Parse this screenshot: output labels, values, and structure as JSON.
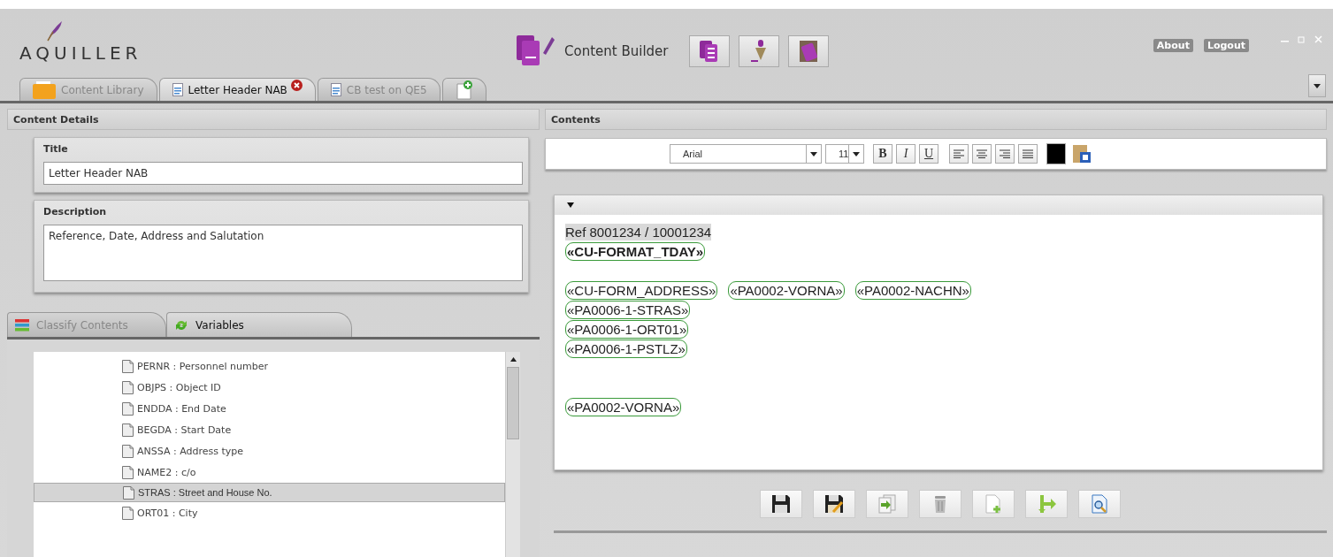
{
  "header": {
    "logo": "AQUILLER",
    "app_title": "Content Builder",
    "links": [
      "About",
      "Logout"
    ]
  },
  "tabs": [
    {
      "label": "Content Library",
      "selected": false,
      "closable": false,
      "kind": "library"
    },
    {
      "label": "Letter Header NAB",
      "selected": true,
      "closable": true,
      "kind": "document"
    },
    {
      "label": "CB test on QE5",
      "selected": false,
      "closable": false,
      "kind": "document"
    }
  ],
  "content_details": {
    "heading": "Content Details",
    "title_label": "Title",
    "title_value": "Letter Header NAB",
    "description_label": "Description",
    "description_value": "Reference, Date, Address and Salutation"
  },
  "sub_tabs": [
    {
      "label": "Classify Contents",
      "selected": false,
      "kind": "classify"
    },
    {
      "label": "Variables",
      "selected": true,
      "kind": "variables"
    }
  ],
  "variables": [
    {
      "label": "PERNR : Personnel number",
      "selected": false
    },
    {
      "label": "OBJPS : Object ID",
      "selected": false
    },
    {
      "label": "ENDDA : End Date",
      "selected": false
    },
    {
      "label": "BEGDA : Start Date",
      "selected": false
    },
    {
      "label": "ANSSA : Address type",
      "selected": false
    },
    {
      "label": "NAME2 : c/o",
      "selected": false
    },
    {
      "label": "STRAS : Street and House No.",
      "selected": true
    },
    {
      "label": "ORT01 : City",
      "selected": false
    }
  ],
  "contents": {
    "heading": "Contents",
    "font": "Arial",
    "size": "11",
    "bold_button": "B",
    "italic_button": "I",
    "underline_button": "U",
    "lines": [
      {
        "kind": "text",
        "segments": [
          {
            "text": "Ref 8001234 / 10001234",
            "kind": "highlight",
            "bold": false
          }
        ]
      },
      {
        "kind": "text",
        "segments": [
          {
            "text": "«CU-FORMAT_TDAY»",
            "kind": "field",
            "bold": true
          }
        ]
      },
      {
        "kind": "blank"
      },
      {
        "kind": "text",
        "segments": [
          {
            "text": "«CU-FORM_ADDRESS»",
            "kind": "field",
            "bold": false
          },
          {
            "text": "«PA0002-VORNA»",
            "kind": "field",
            "bold": false
          },
          {
            "text": "«PA0002-NACHN»",
            "kind": "field",
            "bold": false
          }
        ]
      },
      {
        "kind": "text",
        "segments": [
          {
            "text": "«PA0006-1-STRAS»",
            "kind": "field",
            "bold": false
          }
        ]
      },
      {
        "kind": "text",
        "segments": [
          {
            "text": "«PA0006-1-ORT01»",
            "kind": "field",
            "bold": false
          }
        ]
      },
      {
        "kind": "text",
        "segments": [
          {
            "text": "«PA0006-1-PSTLZ»",
            "kind": "field",
            "bold": false
          }
        ]
      },
      {
        "kind": "blank"
      },
      {
        "kind": "blank"
      },
      {
        "kind": "text",
        "segments": [
          {
            "text": "«PA0002-VORNA»",
            "kind": "field",
            "bold": false
          }
        ]
      }
    ]
  }
}
